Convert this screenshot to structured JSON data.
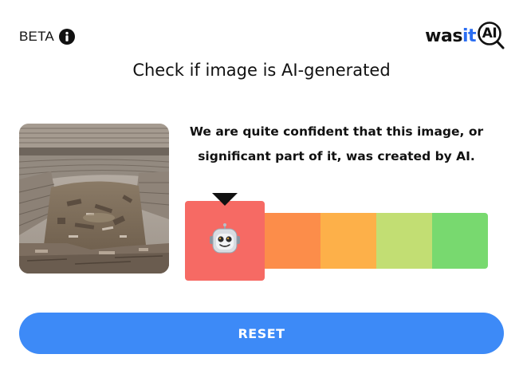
{
  "header": {
    "beta_label": "BETA",
    "info_icon": "info-icon",
    "logo": {
      "was": "was",
      "it": "it",
      "ai": "AI"
    }
  },
  "title": "Check if image is AI-generated",
  "result": {
    "line1": "We are quite confident that this image, or",
    "line2": "significant part of it, was created by AI."
  },
  "meter": {
    "active_level": 1,
    "levels": 5,
    "active_icon": "robot-icon",
    "colors": [
      "#f66a64",
      "#fc8d4a",
      "#fdb049",
      "#c2de73",
      "#78d96f"
    ]
  },
  "reset_label": "RESET",
  "colors": {
    "brand_blue": "#2b6ef2",
    "button_blue": "#3d8af7",
    "text": "#111111"
  }
}
